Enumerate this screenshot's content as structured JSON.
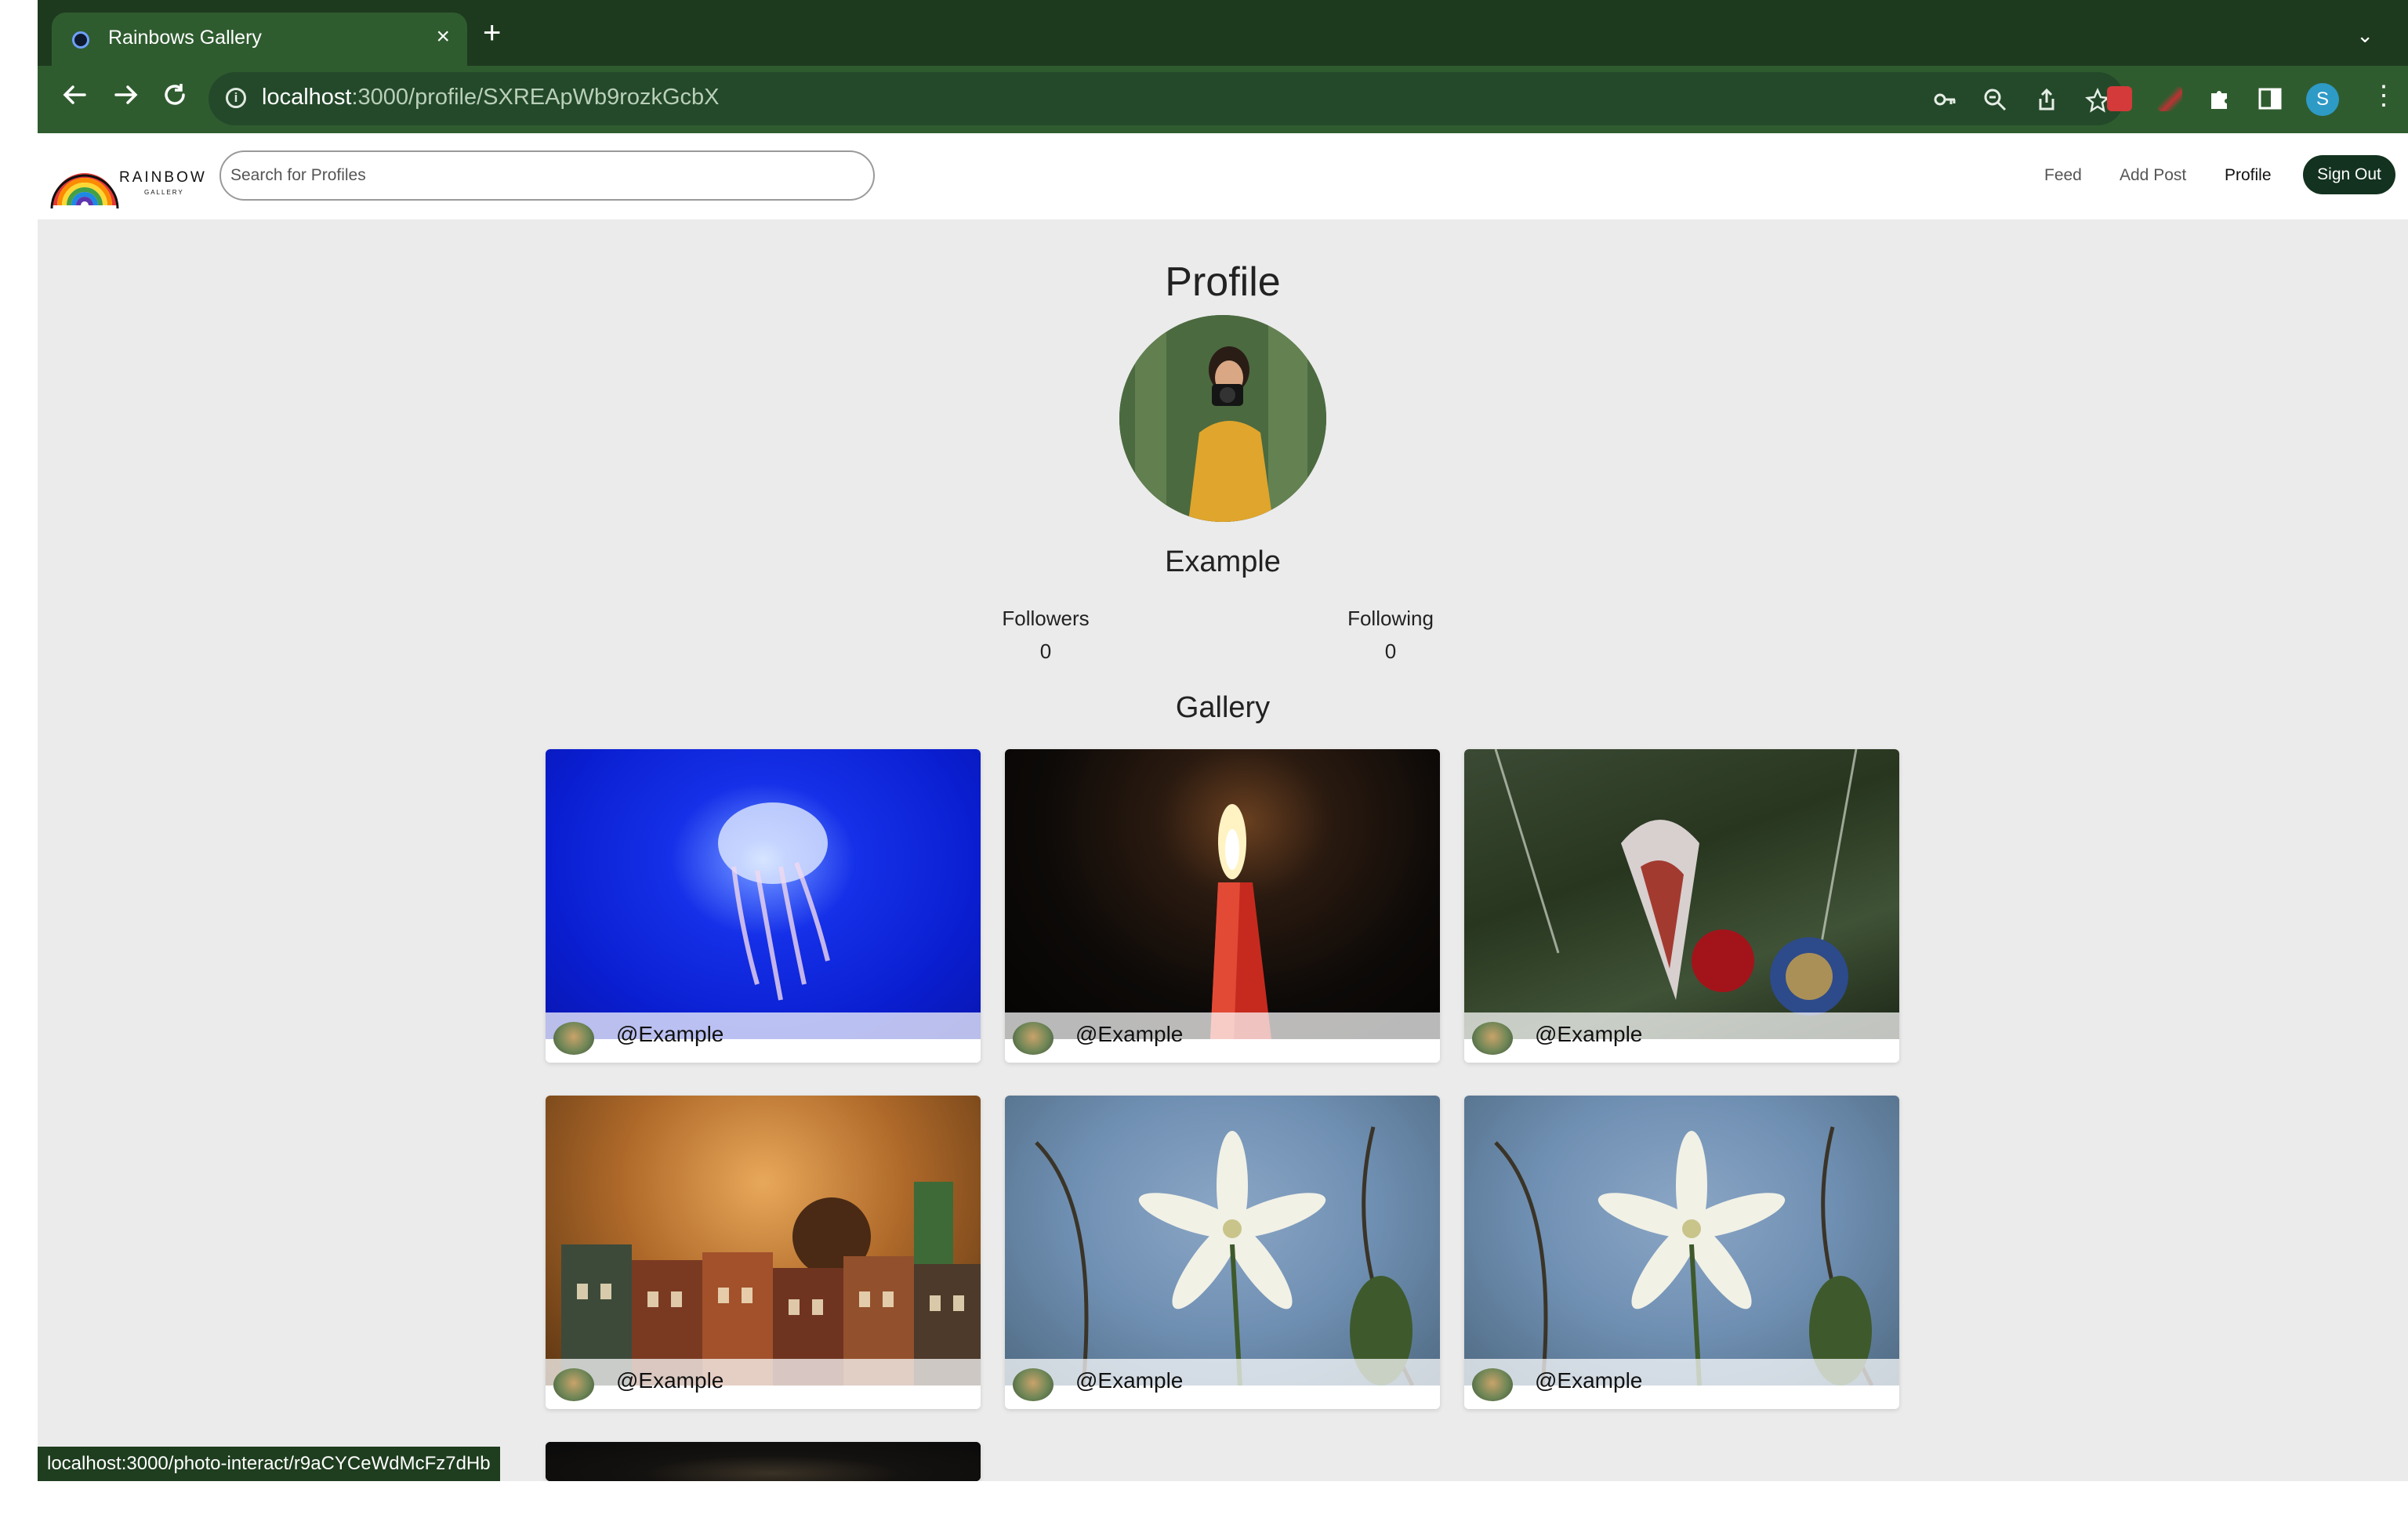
{
  "browser": {
    "tab_title": "Rainbows Gallery",
    "tab_close": "×",
    "new_tab": "+",
    "tab_menu": "⌄",
    "url_host": "localhost",
    "url_rest": ":3000/profile/SXREApWb9rozkGcbX",
    "profile_initial": "S",
    "status_url": "localhost:3000/photo-interact/r9aCYCeWdMcFz7dHb"
  },
  "navbar": {
    "search_placeholder": "Search for Profiles",
    "links": [
      "Feed",
      "Add Post",
      "Profile"
    ],
    "sign_out": "Sign Out"
  },
  "profile": {
    "heading": "Profile",
    "name": "Example",
    "followers_label": "Followers",
    "followers_count": "0",
    "following_label": "Following",
    "following_count": "0",
    "gallery_heading": "Gallery"
  },
  "gallery": [
    {
      "handle": "@Example",
      "image": "jellyfish"
    },
    {
      "handle": "@Example",
      "image": "candle"
    },
    {
      "handle": "@Example",
      "image": "ornament"
    },
    {
      "handle": "@Example",
      "image": "gingerbread-houses"
    },
    {
      "handle": "@Example",
      "image": "white-flower"
    },
    {
      "handle": "@Example",
      "image": "white-flower"
    }
  ]
}
